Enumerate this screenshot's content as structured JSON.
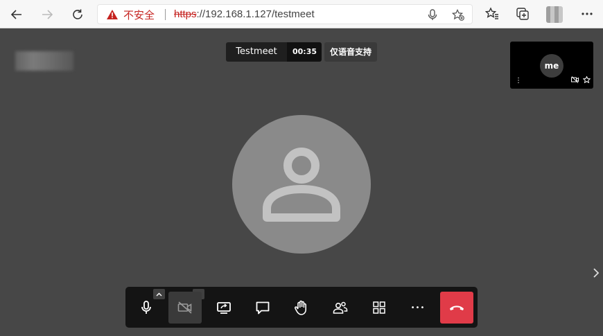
{
  "browser": {
    "security_label": "不安全",
    "url_scheme": "https",
    "url_rest": "://192.168.1.127/testmeet"
  },
  "meeting": {
    "title": "Testmeet",
    "elapsed": "00:35",
    "audio_only_badge": "仅语音支持"
  },
  "self_view": {
    "avatar_label": "me",
    "menu_glyph": "⋮"
  },
  "toolbar": {
    "buttons": [
      {
        "name": "microphone-button",
        "icon": "microphone-icon"
      },
      {
        "name": "camera-button",
        "icon": "camera-off-icon",
        "active": true
      },
      {
        "name": "share-screen-button",
        "icon": "screen-share-icon"
      },
      {
        "name": "chat-button",
        "icon": "chat-icon"
      },
      {
        "name": "raise-hand-button",
        "icon": "hand-icon"
      },
      {
        "name": "participants-button",
        "icon": "participants-icon"
      },
      {
        "name": "tile-view-button",
        "icon": "grid-icon"
      },
      {
        "name": "more-button",
        "icon": "more-icon"
      },
      {
        "name": "hangup-button",
        "icon": "hangup-icon"
      }
    ],
    "more_glyph": "•••"
  },
  "colors": {
    "hangup": "#e03b48",
    "insecure": "#c5221f",
    "stage_bg": "#474747"
  }
}
